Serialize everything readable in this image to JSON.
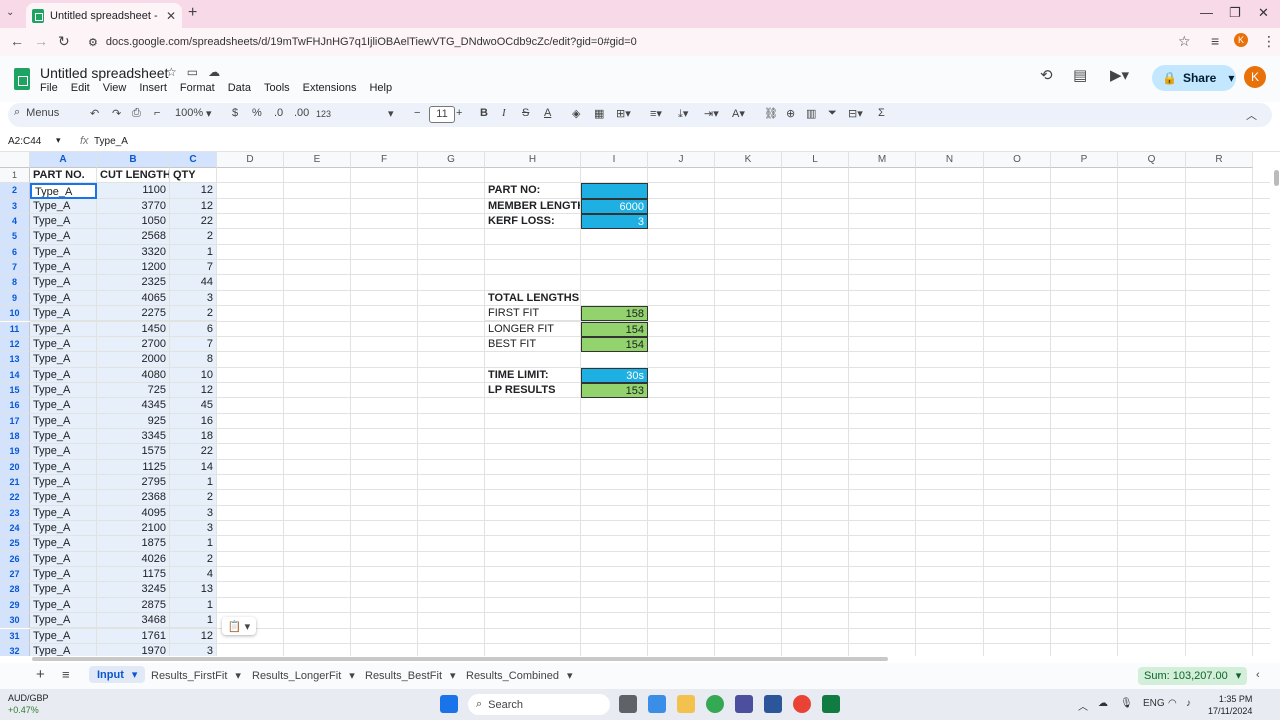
{
  "browser": {
    "tab_title": "Untitled spreadsheet - Google",
    "url": "docs.google.com/spreadsheets/d/19mTwFHJnHG7q1IjliOBAelTiewVTG_DNdwoOCdb9cZc/edit?gid=0#gid=0"
  },
  "app": {
    "doc_title": "Untitled spreadsheet",
    "menu": [
      "File",
      "Edit",
      "View",
      "Insert",
      "Format",
      "Data",
      "Tools",
      "Extensions",
      "Help"
    ],
    "share_label": "Share",
    "avatar_letter": "K"
  },
  "toolbar": {
    "menus_label": "Menus",
    "zoom": "100%",
    "currency": "$",
    "percent": "%",
    "dec_less": ".0",
    "dec_more": ".00",
    "num_format": "123",
    "font_size": "11"
  },
  "formula_bar": {
    "name_box": "A2:C44",
    "fx": "fx",
    "value": "Type_A"
  },
  "columns": [
    "A",
    "B",
    "C",
    "D",
    "E",
    "F",
    "G",
    "H",
    "I",
    "J",
    "K",
    "L",
    "M",
    "N",
    "O",
    "P",
    "Q",
    "R"
  ],
  "rows": [
    "1",
    "2",
    "3",
    "4",
    "5",
    "6",
    "7",
    "8",
    "9",
    "10",
    "11",
    "12",
    "13",
    "14",
    "15",
    "16",
    "17",
    "18",
    "19",
    "20",
    "21",
    "22",
    "23",
    "24",
    "25",
    "26",
    "27",
    "28",
    "29",
    "30",
    "31",
    "32"
  ],
  "table": {
    "headers": [
      "PART NO.",
      "CUT LENGTH",
      "QTY"
    ],
    "data": [
      [
        "Type_A",
        "1100",
        "12"
      ],
      [
        "Type_A",
        "3770",
        "12"
      ],
      [
        "Type_A",
        "1050",
        "22"
      ],
      [
        "Type_A",
        "2568",
        "2"
      ],
      [
        "Type_A",
        "3320",
        "1"
      ],
      [
        "Type_A",
        "1200",
        "7"
      ],
      [
        "Type_A",
        "2325",
        "44"
      ],
      [
        "Type_A",
        "4065",
        "3"
      ],
      [
        "Type_A",
        "2275",
        "2"
      ],
      [
        "Type_A",
        "1450",
        "6"
      ],
      [
        "Type_A",
        "2700",
        "7"
      ],
      [
        "Type_A",
        "2000",
        "8"
      ],
      [
        "Type_A",
        "4080",
        "10"
      ],
      [
        "Type_A",
        "725",
        "12"
      ],
      [
        "Type_A",
        "4345",
        "45"
      ],
      [
        "Type_A",
        "925",
        "16"
      ],
      [
        "Type_A",
        "3345",
        "18"
      ],
      [
        "Type_A",
        "1575",
        "22"
      ],
      [
        "Type_A",
        "1125",
        "14"
      ],
      [
        "Type_A",
        "2795",
        "1"
      ],
      [
        "Type_A",
        "2368",
        "2"
      ],
      [
        "Type_A",
        "4095",
        "3"
      ],
      [
        "Type_A",
        "2100",
        "3"
      ],
      [
        "Type_A",
        "1875",
        "1"
      ],
      [
        "Type_A",
        "4026",
        "2"
      ],
      [
        "Type_A",
        "1175",
        "4"
      ],
      [
        "Type_A",
        "3245",
        "13"
      ],
      [
        "Type_A",
        "2875",
        "1"
      ],
      [
        "Type_A",
        "3468",
        "1"
      ],
      [
        "Type_A",
        "1761",
        "12"
      ],
      [
        "Type_A",
        "1970",
        "3"
      ]
    ]
  },
  "params": {
    "part_no_label": "PART NO:",
    "part_no_value": "",
    "member_length_label": "MEMBER LENGTH:",
    "member_length_value": "6000",
    "kerf_loss_label": "KERF LOSS:",
    "kerf_loss_value": "3",
    "total_lengths_label": "TOTAL LENGTHS:",
    "first_fit_label": "FIRST FIT",
    "first_fit_value": "158",
    "longer_fit_label": "LONGER FIT",
    "longer_fit_value": "154",
    "best_fit_label": "BEST FIT",
    "best_fit_value": "154",
    "time_limit_label": "TIME LIMIT:",
    "time_limit_value": "30s",
    "lp_results_label": "LP RESULTS",
    "lp_results_value": "153",
    "input_color": "#1fb0e3",
    "result_color": "#92d36e"
  },
  "sheet_tabs": [
    "Input",
    "Results_FirstFit",
    "Results_LongerFit",
    "Results_BestFit",
    "Results_Combined"
  ],
  "active_sheet": "Input",
  "sum_label": "Sum: 103,207.00",
  "taskbar": {
    "ticker_name": "AUD/GBP",
    "ticker_change": "+0.47%",
    "search_label": "Search",
    "lang": "ENG",
    "time": "1:35 PM",
    "date": "17/11/2024"
  }
}
